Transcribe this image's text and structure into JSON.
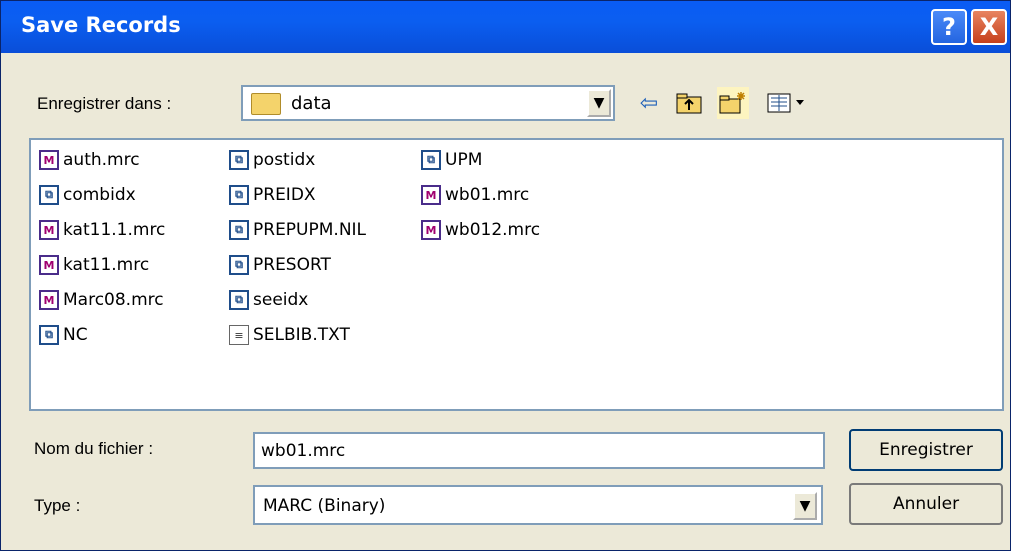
{
  "window": {
    "title": "Save Records"
  },
  "location": {
    "label": "Enregistrer dans :",
    "folder": "data"
  },
  "toolbar": {
    "back_icon": "back-arrow-icon",
    "up_icon": "folder-up-icon",
    "new_folder_icon": "new-folder-icon",
    "view_menu_icon": "view-menu-icon"
  },
  "files": [
    {
      "name": "auth.mrc",
      "type": "mrc"
    },
    {
      "name": "combidx",
      "type": "idx"
    },
    {
      "name": "kat11.1.mrc",
      "type": "mrc"
    },
    {
      "name": "kat11.mrc",
      "type": "mrc"
    },
    {
      "name": "Marc08.mrc",
      "type": "mrc"
    },
    {
      "name": "NC",
      "type": "idx"
    },
    {
      "name": "postidx",
      "type": "idx"
    },
    {
      "name": "PREIDX",
      "type": "idx"
    },
    {
      "name": "PREPUPM.NIL",
      "type": "idx"
    },
    {
      "name": "PRESORT",
      "type": "idx"
    },
    {
      "name": "seeidx",
      "type": "idx"
    },
    {
      "name": "SELBIB.TXT",
      "type": "txt"
    },
    {
      "name": "UPM",
      "type": "idx"
    },
    {
      "name": "wb01.mrc",
      "type": "mrc"
    },
    {
      "name": "wb012.mrc",
      "type": "mrc"
    }
  ],
  "filename": {
    "label": "Nom du fichier :",
    "value": "wb01.mrc"
  },
  "filetype": {
    "label": "Type :",
    "value": "MARC (Binary)"
  },
  "buttons": {
    "save": "Enregistrer",
    "cancel": "Annuler",
    "help": "?",
    "close": "X"
  },
  "colors": {
    "titlebar": "#0a5cf5",
    "window": "#ece9d8",
    "mrc_icon": "#a00070"
  }
}
